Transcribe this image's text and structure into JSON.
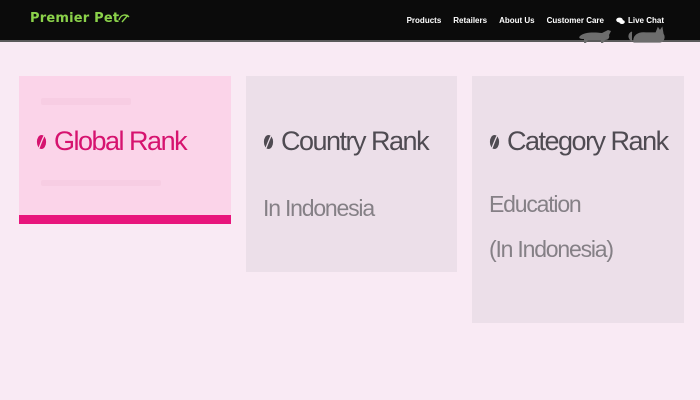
{
  "header": {
    "logo_text": "Premier Pet",
    "nav": [
      {
        "label": "Products"
      },
      {
        "label": "Retailers"
      },
      {
        "label": "About Us"
      },
      {
        "label": "Customer Care"
      },
      {
        "label": "Live Chat",
        "icon": "chat-bubbles-icon"
      }
    ]
  },
  "cards": {
    "global": {
      "title": "Global Rank",
      "accent_color": "#e8157c"
    },
    "country": {
      "title": "Country Rank",
      "subtitle": "In Indonesia"
    },
    "category": {
      "title": "Category Rank",
      "subtitle_line1": "Education",
      "subtitle_line2": "(In Indonesia)"
    }
  },
  "colors": {
    "header_bg": "#0b0b0b",
    "logo": "#8bd24a",
    "page_bg": "#f9eaf4",
    "accent": "#d6136f"
  }
}
